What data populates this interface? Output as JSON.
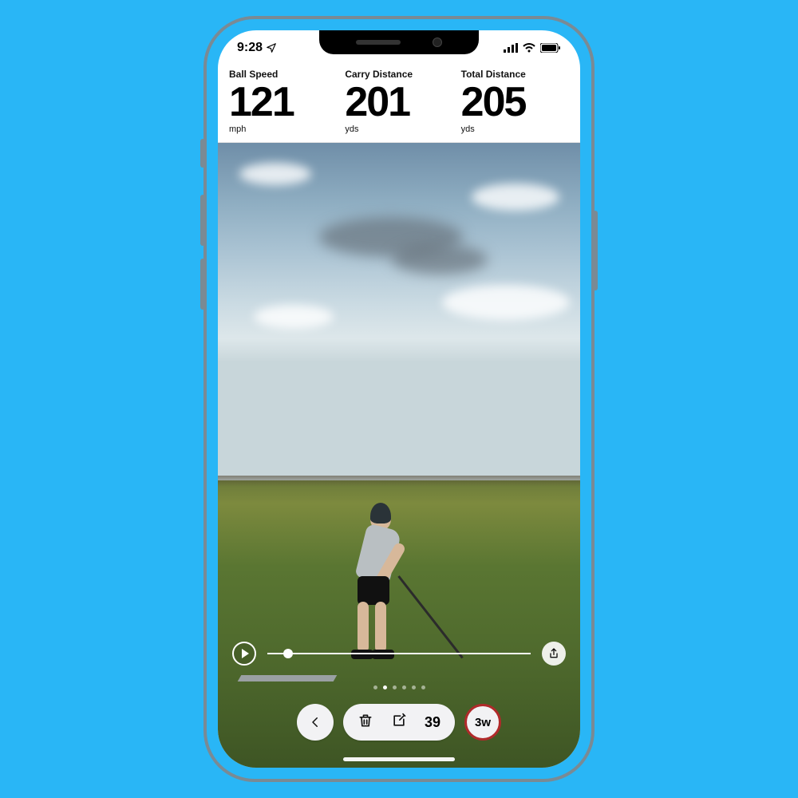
{
  "status": {
    "time": "9:28",
    "location_active": true
  },
  "metrics": [
    {
      "label": "Ball Speed",
      "value": "121",
      "unit": "mph"
    },
    {
      "label": "Carry Distance",
      "value": "201",
      "unit": "yds"
    },
    {
      "label": "Total Distance",
      "value": "205",
      "unit": "yds"
    }
  ],
  "pager": {
    "count": 6,
    "active_index": 1
  },
  "toolbar": {
    "shot_number": "39",
    "club": "3w"
  }
}
